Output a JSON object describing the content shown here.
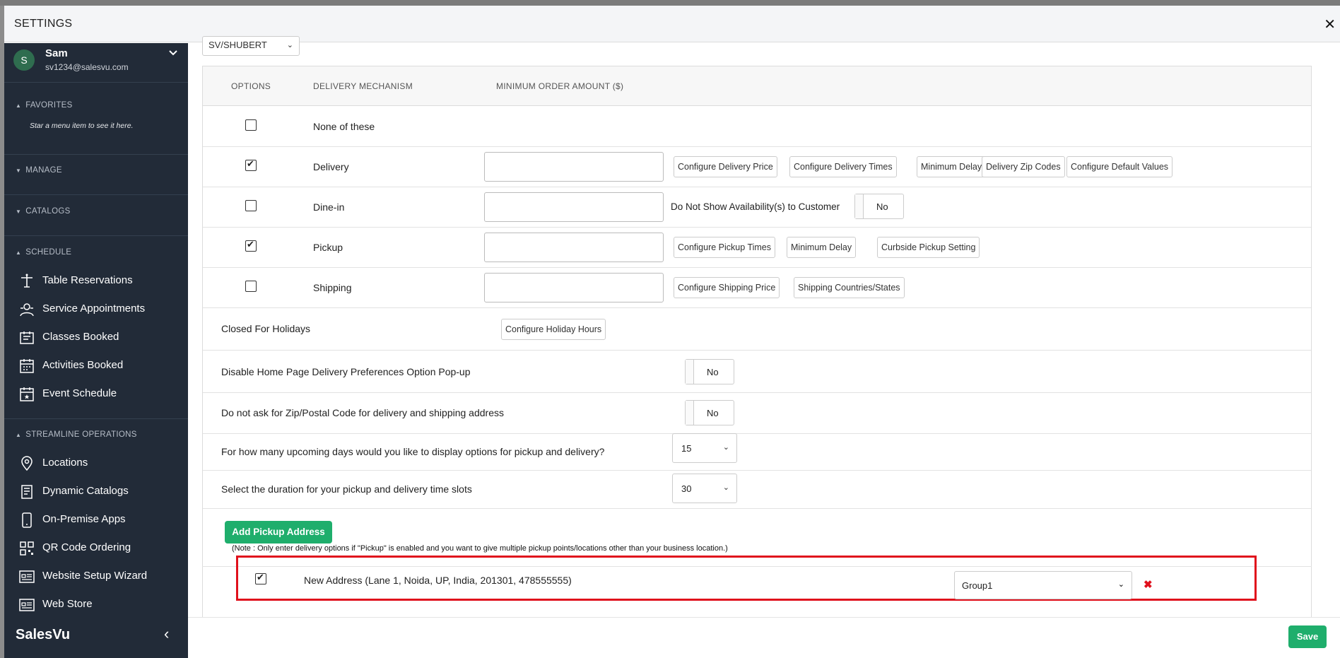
{
  "modal": {
    "title": "SETTINGS",
    "close_icon": "close-icon"
  },
  "user": {
    "initial": "S",
    "name": "Sam",
    "email": "sv1234@salesvu.com"
  },
  "sidebar": {
    "sections": {
      "favorites": "FAVORITES",
      "favorites_hint": "Star a menu item to see it here.",
      "manage": "MANAGE",
      "catalogs": "CATALOGS",
      "schedule": "SCHEDULE",
      "streamline": "STREAMLINE OPERATIONS"
    },
    "schedule_items": [
      {
        "label": "Table Reservations",
        "icon": "table-icon"
      },
      {
        "label": "Service Appointments",
        "icon": "appointments-icon"
      },
      {
        "label": "Classes Booked",
        "icon": "classes-icon"
      },
      {
        "label": "Activities Booked",
        "icon": "activities-icon"
      },
      {
        "label": "Event Schedule",
        "icon": "event-icon"
      }
    ],
    "streamline_items": [
      {
        "label": "Locations",
        "icon": "location-pin-icon"
      },
      {
        "label": "Dynamic Catalogs",
        "icon": "catalog-icon"
      },
      {
        "label": "On-Premise Apps",
        "icon": "apps-icon"
      },
      {
        "label": "QR Code Ordering",
        "icon": "qr-code-icon"
      },
      {
        "label": "Website Setup Wizard",
        "icon": "website-icon"
      },
      {
        "label": "Web Store",
        "icon": "web-store-icon"
      }
    ],
    "brand": "SalesVu"
  },
  "main": {
    "store_value": "SV/SHUBERT",
    "headers": {
      "options": "OPTIONS",
      "mechanism": "DELIVERY MECHANISM",
      "min_amount": "MINIMUM ORDER AMOUNT ($)"
    },
    "rows": [
      {
        "label": "None of these",
        "checked": false
      },
      {
        "label": "Delivery",
        "checked": true,
        "buttons": [
          "Configure Delivery Price",
          "Configure Delivery Times",
          "Minimum Delay",
          "Delivery Zip Codes",
          "Configure Default Values"
        ]
      },
      {
        "label": "Dine-in",
        "checked": false,
        "text": "Do Not Show Availability(s) to Customer",
        "toggle": "No"
      },
      {
        "label": "Pickup",
        "checked": true,
        "buttons": [
          "Configure Pickup Times",
          "Minimum Delay",
          "Curbside Pickup Setting"
        ]
      },
      {
        "label": "Shipping",
        "checked": false,
        "buttons": [
          "Configure Shipping Price",
          "Shipping Countries/States"
        ]
      }
    ],
    "holidays": {
      "label": "Closed For Holidays",
      "button": "Configure Holiday Hours"
    },
    "popup": {
      "label": "Disable Home Page Delivery Preferences Option Pop-up",
      "value": "No"
    },
    "zip": {
      "label": "Do not ask for Zip/Postal Code for delivery and shipping address",
      "value": "No"
    },
    "days": {
      "label": "For how many upcoming days would you like to display options for pickup and delivery?",
      "value": "15"
    },
    "duration": {
      "label": "Select the duration for your pickup and delivery time slots",
      "value": "30"
    },
    "add_pickup": "Add Pickup Address",
    "note": "(Note : Only enter delivery options if \"Pickup\" is enabled and you want to give multiple pickup points/locations other than your business location.)",
    "address": {
      "checked": true,
      "text": "New Address (Lane 1, Noida, UP, India, 201301, 478555555)",
      "group": "Group1"
    },
    "save": "Save"
  }
}
